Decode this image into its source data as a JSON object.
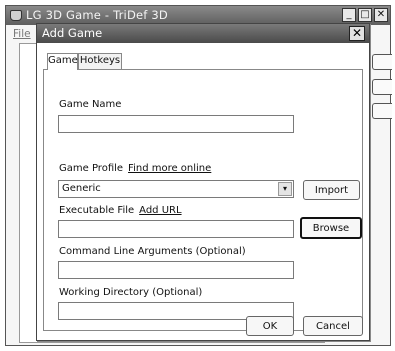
{
  "app_window": {
    "title": "LG 3D Game - TriDef 3D",
    "controls": {
      "minimize": "_",
      "maximize": "□",
      "close": "✕"
    },
    "menu": {
      "file": "File"
    }
  },
  "dialog": {
    "title": "Add Game",
    "close_glyph": "✕",
    "tabs": [
      {
        "label": "Game"
      },
      {
        "label": "Hotkeys"
      }
    ],
    "game_name": {
      "label": "Game Name",
      "value": ""
    },
    "game_profile": {
      "label": "Game Profile",
      "link": "Find more online",
      "selected": "Generic",
      "arrow": "▾",
      "import_label": "Import"
    },
    "executable": {
      "label": "Executable File",
      "link": "Add URL",
      "value": "",
      "browse_label": "Browse"
    },
    "command_line": {
      "label": "Command Line Arguments (Optional)",
      "value": ""
    },
    "working_dir": {
      "label": "Working Directory (Optional)",
      "value": ""
    },
    "ok_label": "OK",
    "cancel_label": "Cancel"
  }
}
